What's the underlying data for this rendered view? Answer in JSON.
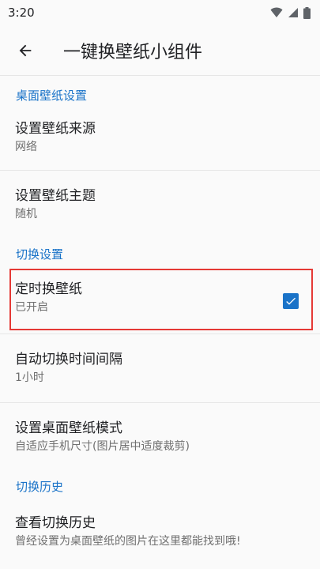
{
  "status_bar": {
    "time": "3:20",
    "icons": [
      "wifi-icon",
      "signal-icon",
      "battery-icon"
    ]
  },
  "app_bar": {
    "back_icon": "arrow-left-icon",
    "title": "一键换壁纸小组件"
  },
  "colors": {
    "accent": "#1a73c8",
    "highlight_border": "#e53935"
  },
  "sections": [
    {
      "header": "桌面壁纸设置",
      "items": [
        {
          "title": "设置壁纸来源",
          "summary": "网络"
        },
        {
          "title": "设置壁纸主题",
          "summary": "随机"
        }
      ]
    },
    {
      "header": "切换设置",
      "items": [
        {
          "title": "定时换壁纸",
          "summary": "已开启",
          "checked": true
        },
        {
          "title": "自动切换时间间隔",
          "summary": "1小时"
        },
        {
          "title": "设置桌面壁纸模式",
          "summary": "自适应手机尺寸(图片居中适度裁剪)"
        }
      ]
    },
    {
      "header": "切换历史",
      "items": [
        {
          "title": "查看切换历史",
          "summary": "曾经设置为桌面壁纸的图片在这里都能找到哦!"
        }
      ]
    }
  ]
}
